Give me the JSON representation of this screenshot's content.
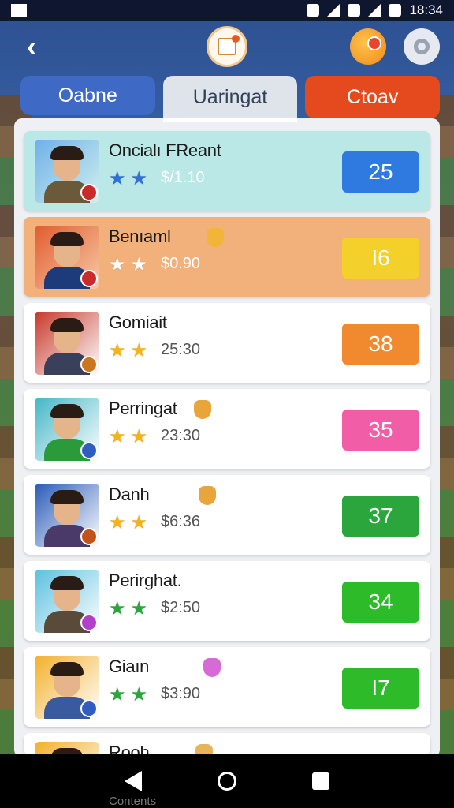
{
  "status_bar": {
    "time": "18:34"
  },
  "tabs": [
    {
      "label": "Oabne"
    },
    {
      "label": "Uaringat"
    },
    {
      "label": "Ctoav"
    }
  ],
  "rows": [
    {
      "name": "Oncialı FReant",
      "stat": "$/1.10",
      "score": "25",
      "star_color": "#2f6fd8",
      "score_color": "#2f7ae0",
      "rank_color": "#c92a2a",
      "body_color": "#6a5a3a",
      "bg": "#6fb0e8",
      "highlight": "blue"
    },
    {
      "name": "Benıaml",
      "stat": "$0.90",
      "score": "I6",
      "star_color": "#ffffff",
      "score_color": "#f4d02b",
      "rank_color": "#c92a2a",
      "body_color": "#1d3a7a",
      "bg": "#e25b2f",
      "highlight": "orange"
    },
    {
      "name": "Gomiait",
      "stat": "25:30",
      "score": "38",
      "star_color": "#f5b412",
      "score_color": "#f18a2e",
      "rank_color": "#c8771f",
      "body_color": "#3a3f5a",
      "bg": "#c7382a",
      "highlight": ""
    },
    {
      "name": "Perringat",
      "stat": "23:30",
      "score": "35",
      "star_color": "#f5b412",
      "score_color": "#f25da8",
      "rank_color": "#2f5ec0",
      "body_color": "#2b9a3a",
      "bg": "#44b6c6",
      "highlight": ""
    },
    {
      "name": "Danh",
      "stat": "$6:36",
      "score": "37",
      "star_color": "#f5b412",
      "score_color": "#2aa63d",
      "rank_color": "#c0521a",
      "body_color": "#4a3a6a",
      "bg": "#2a5ab8",
      "highlight": ""
    },
    {
      "name": "Perirghat.",
      "stat": "$2:50",
      "score": "34",
      "star_color": "#2aa63d",
      "score_color": "#2dbb2a",
      "rank_color": "#b23fc9",
      "body_color": "#5a4a3a",
      "bg": "#5cc0e0",
      "highlight": ""
    },
    {
      "name": "Giaın",
      "stat": "$3:90",
      "score": "I7",
      "star_color": "#2aa63d",
      "score_color": "#2dbb2a",
      "rank_color": "#2f5ec0",
      "body_color": "#3a5aa0",
      "bg": "#f3b02b",
      "highlight": ""
    },
    {
      "name": "Rooh",
      "stat": "",
      "score": "",
      "star_color": "#f5b412",
      "score_color": "#f18a2e",
      "rank_color": "#2f5ec0",
      "body_color": "#3a3a3a",
      "bg": "#f3b02b",
      "highlight": ""
    }
  ],
  "nav": {
    "caption": "Contents"
  }
}
